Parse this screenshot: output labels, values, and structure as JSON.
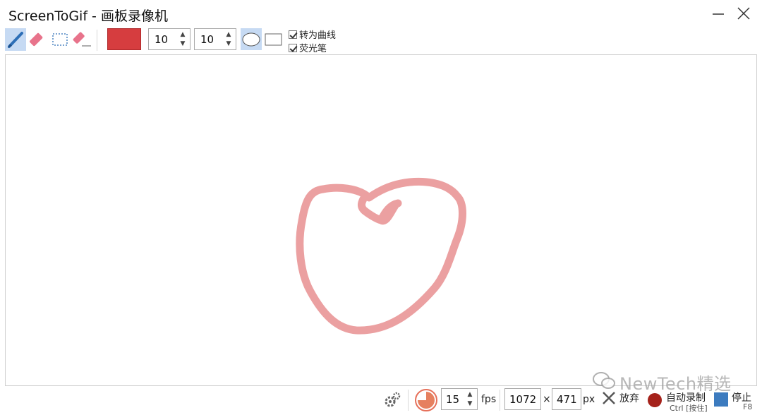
{
  "window": {
    "title": "ScreenToGif - 画板录像机"
  },
  "toolbar": {
    "pen_width": "10",
    "pen_height": "10",
    "color": "#d63d3f",
    "checkbox_curve": {
      "label": "转为曲线",
      "checked": true
    },
    "checkbox_highlighter": {
      "label": "荧光笔",
      "checked": true
    }
  },
  "canvas": {
    "stroke_color": "#eba0a1",
    "drawing": "apple-sketch"
  },
  "statusbar": {
    "fps_value": "15",
    "fps_label": "fps",
    "width_value": "1072",
    "times_sign": "×",
    "height_value": "471",
    "px_label": "px",
    "discard_label": "放弃",
    "auto_record_label": "自动录制",
    "auto_record_shortcut": "Ctrl [按住]",
    "stop_label": "停止",
    "stop_shortcut": "F8"
  },
  "watermark": {
    "text": "NewTech精选"
  }
}
